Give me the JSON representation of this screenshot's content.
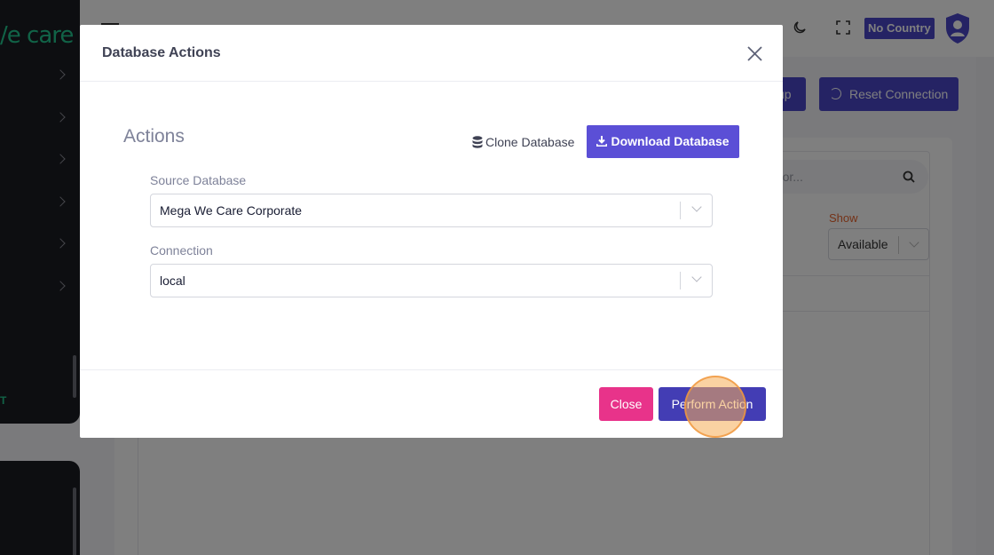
{
  "app": {
    "brand_text": "/e care",
    "sidebar_footer_text": "T",
    "country_badge": "No Country",
    "header_buttons": {
      "backup_label": "up",
      "reset_connection_label": "Reset Connection"
    },
    "search": {
      "placeholder": "h for..."
    },
    "show_filter": {
      "label": "Show",
      "value": "Available"
    }
  },
  "modal": {
    "title": "Database Actions",
    "section_title": "Actions",
    "clone_button_label": "Clone Database",
    "download_button_label": "Download Database",
    "source_database": {
      "label": "Source Database",
      "value": "Mega We Care Corporate"
    },
    "connection": {
      "label": "Connection",
      "value": "local"
    },
    "footer": {
      "close_label": "Close",
      "perform_label": "Perform Action"
    }
  },
  "colors": {
    "primary": "#5b4fd6",
    "primary_dark": "#433db4",
    "danger": "#e8338a",
    "brand_green": "#22c78f"
  },
  "icons": [
    "close-icon",
    "database-icon",
    "download-icon",
    "chevron-down-icon",
    "moon-icon",
    "fullscreen-icon",
    "search-icon",
    "reset-icon",
    "avatar-icon"
  ]
}
